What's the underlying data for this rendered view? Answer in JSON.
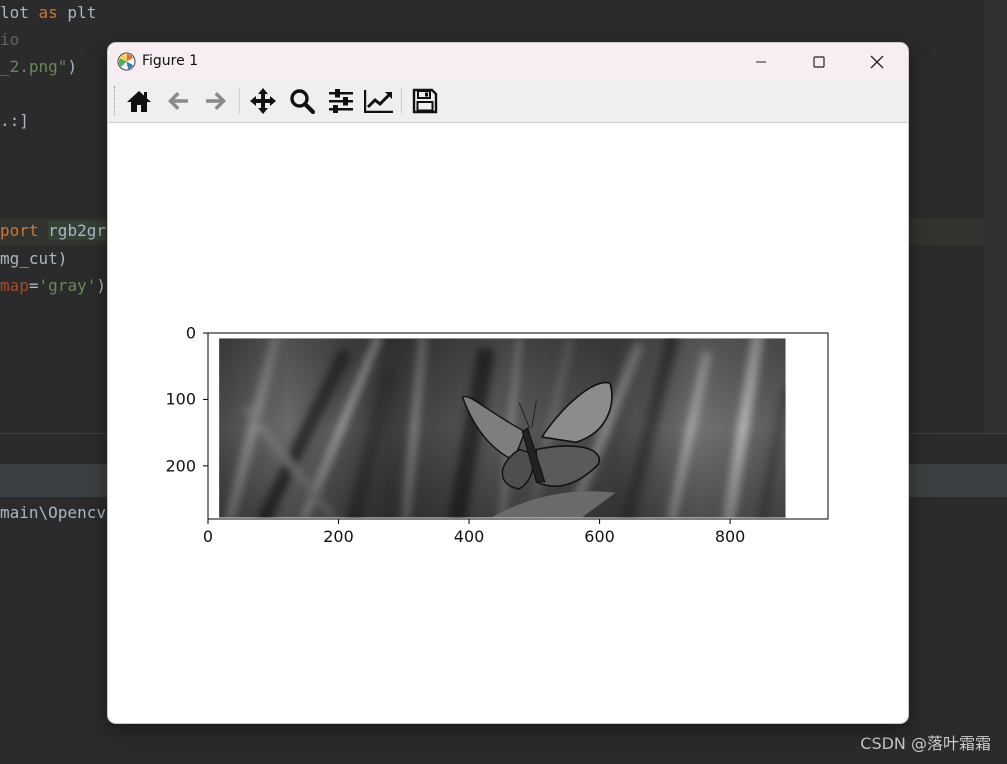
{
  "editor": {
    "lines": [
      {
        "segments": [
          {
            "t": "lot ",
            "c": "plain"
          },
          {
            "t": "as",
            "c": "kw"
          },
          {
            "t": " plt",
            "c": "plain"
          }
        ]
      },
      {
        "segments": [
          {
            "t": "io",
            "c": "cmt"
          }
        ]
      },
      {
        "segments": [
          {
            "t": "_2.png\"",
            "c": "str"
          },
          {
            "t": ")",
            "c": "plain"
          }
        ]
      },
      {
        "segments": []
      },
      {
        "segments": [
          {
            "t": ".",
            "c": "plain"
          },
          {
            "t": ":]",
            "c": "plain"
          }
        ]
      },
      {
        "segments": []
      },
      {
        "segments": []
      },
      {
        "segments": []
      },
      {
        "segments": [
          {
            "t": "port",
            "c": "kw"
          },
          {
            "t": " ",
            "c": "plain"
          },
          {
            "t": "rgb2gr",
            "c": "hl"
          }
        ]
      },
      {
        "segments": [
          {
            "t": "mg_cut)",
            "c": "plain"
          }
        ]
      },
      {
        "segments": [
          {
            "t": "map",
            "c": "param"
          },
          {
            "t": "=",
            "c": "plain"
          },
          {
            "t": "'gray'",
            "c": "str"
          },
          {
            "t": ")",
            "c": "plain"
          }
        ]
      }
    ]
  },
  "console": {
    "path_text": "main\\Opencv"
  },
  "watermark": "CSDN @落叶霜霜",
  "figure": {
    "title": "Figure 1",
    "toolbar": {
      "home": "home-icon",
      "back": "arrow-left-icon",
      "forward": "arrow-right-icon",
      "pan": "move-icon",
      "zoom": "zoom-icon",
      "configure": "sliders-icon",
      "edit": "chart-line-icon",
      "save": "save-icon"
    }
  },
  "chart_data": {
    "type": "image",
    "colormap": "gray",
    "xticks": [
      "0",
      "200",
      "400",
      "600",
      "800"
    ],
    "yticks": [
      "0",
      "100",
      "200"
    ],
    "xlim": [
      0,
      950
    ],
    "ylim": [
      280,
      0
    ],
    "image_extent": {
      "x": [
        17,
        885
      ],
      "y": [
        8,
        278
      ]
    }
  }
}
